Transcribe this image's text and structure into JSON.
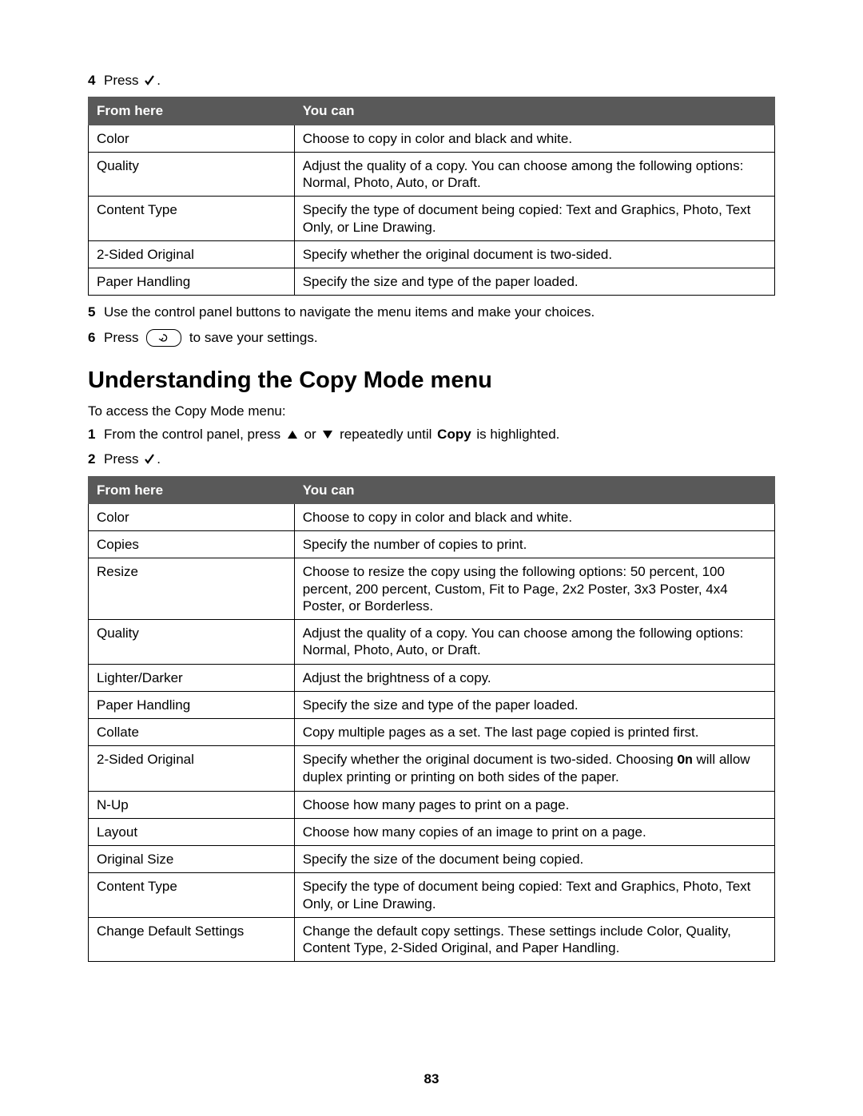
{
  "step4": {
    "num": "4",
    "text_before": "Press ",
    "text_after": "."
  },
  "table1": {
    "h_from": "From here",
    "h_you": "You can",
    "rows": [
      {
        "from": "Color",
        "you": "Choose to copy in color and black and white."
      },
      {
        "from": "Quality",
        "you": "Adjust the quality of a copy. You can choose among the following options: Normal, Photo, Auto, or Draft."
      },
      {
        "from": "Content Type",
        "you": "Specify the type of document being copied: Text and Graphics, Photo, Text Only, or Line Drawing."
      },
      {
        "from": "2-Sided Original",
        "you": "Specify whether the original document is two-sided."
      },
      {
        "from": "Paper Handling",
        "you": "Specify the size and type of the paper loaded."
      }
    ]
  },
  "step5": {
    "num": "5",
    "text": "Use the control panel buttons to navigate the menu items and make your choices."
  },
  "step6": {
    "num": "6",
    "text_before": "Press ",
    "text_after": " to save your settings."
  },
  "section_heading": "Understanding the Copy Mode menu",
  "intro_text": "To access the Copy Mode menu:",
  "step_c1": {
    "num": "1",
    "before": "From the control panel, press ",
    "or": " or ",
    "after1": " repeatedly until ",
    "bold": "Copy",
    "after2": " is highlighted."
  },
  "step_c2": {
    "num": "2",
    "text_before": "Press ",
    "text_after": "."
  },
  "table2": {
    "h_from": "From here",
    "h_you": "You can",
    "rows": [
      {
        "from": "Color",
        "you": "Choose to copy in color and black and white."
      },
      {
        "from": "Copies",
        "you": "Specify the number of copies to print."
      },
      {
        "from": "Resize",
        "you": "Choose to resize the copy using the following options: 50 percent, 100 percent, 200 percent, Custom, Fit to Page, 2x2 Poster, 3x3 Poster, 4x4 Poster, or Borderless."
      },
      {
        "from": "Quality",
        "you": "Adjust the quality of a copy. You can choose among the following options: Normal, Photo, Auto, or Draft."
      },
      {
        "from": "Lighter/Darker",
        "you": "Adjust the brightness of a copy."
      },
      {
        "from": "Paper Handling",
        "you": "Specify the size and type of the paper loaded."
      },
      {
        "from": "Collate",
        "you": "Copy multiple pages as a set. The last page copied is printed first."
      },
      {
        "from": "2-Sided Original",
        "you_pre": "Specify whether the original document is two-sided. Choosing ",
        "you_mono": "On",
        "you_post": " will allow duplex printing or printing on both sides of the paper."
      },
      {
        "from": "N-Up",
        "you": "Choose how many pages to print on a page."
      },
      {
        "from": "Layout",
        "you": "Choose how many copies of an image to print on a page."
      },
      {
        "from": "Original Size",
        "you": "Specify the size of the document being copied."
      },
      {
        "from": "Content Type",
        "you": "Specify the type of document being copied: Text and Graphics, Photo, Text Only, or Line Drawing."
      },
      {
        "from": "Change Default Settings",
        "you": "Change the default copy settings. These settings include Color, Quality, Content Type, 2-Sided Original, and Paper Handling."
      }
    ]
  },
  "page_number": "83"
}
